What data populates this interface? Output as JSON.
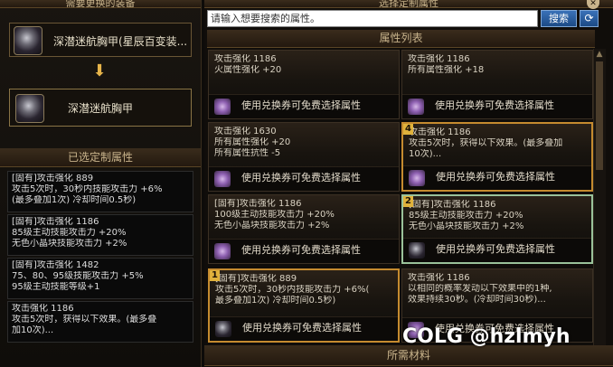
{
  "left": {
    "top_header": "需要更换的装备",
    "source_item_label": "深潜迷航胸甲(星辰百变装...",
    "target_item_label": "深潜迷航胸甲",
    "selected_header": "已选定制属性",
    "selected_attrs": [
      {
        "lines": [
          "[固有]攻击强化 889",
          "攻击5次时，30秒内技能攻击力 +6%",
          "(最多叠加1次) 冷却时间0.5秒)"
        ]
      },
      {
        "lines": [
          "[固有]攻击强化 1186",
          "85级主动技能攻击力 +20%",
          "无色小晶块技能攻击力 +2%"
        ]
      },
      {
        "lines": [
          "[固有]攻击强化 1482",
          "75、80、95级技能攻击力 +5%",
          "95级主动技能等级+1"
        ]
      },
      {
        "lines": [
          "攻击强化 1186",
          "攻击5次时，获得以下效果。(最多叠",
          "加10次)..."
        ]
      }
    ]
  },
  "right": {
    "top_header": "选择定制属性",
    "search_placeholder": "请输入想要搜索的属性。",
    "search_button": "搜索",
    "refresh_icon": "⟳",
    "list_header": "属性列表",
    "footer_text": "使用兑换券可免费选择属性",
    "cards": [
      {
        "lines": [
          "攻击强化 1186",
          "火属性强化 +20"
        ],
        "badge": "",
        "state": "normal",
        "token": "purple"
      },
      {
        "lines": [
          "攻击强化 1186",
          "所有属性强化 +18"
        ],
        "badge": "",
        "state": "normal",
        "token": "purple"
      },
      {
        "lines": [
          "攻击强化 1630",
          "所有属性强化 +20",
          "所有属性抗性 -5"
        ],
        "badge": "",
        "state": "normal",
        "token": "purple"
      },
      {
        "lines": [
          "攻击强化 1186",
          "攻击5次时，获得以下效果。(最多叠加",
          "10次)..."
        ],
        "badge": "4",
        "state": "sel",
        "token": "purple"
      },
      {
        "lines": [
          "[固有]攻击强化 1186",
          "100级主动技能攻击力 +20%",
          "无色小晶块技能攻击力 +2%"
        ],
        "badge": "",
        "state": "normal",
        "token": "purple"
      },
      {
        "lines": [
          "[固有]攻击强化 1186",
          "85级主动技能攻击力 +20%",
          "无色小晶块技能攻击力 +2%"
        ],
        "badge": "2",
        "state": "sel2",
        "token": "dark"
      },
      {
        "lines": [
          "[固有]攻击强化 889",
          "攻击5次时，30秒内技能攻击力 +6%(",
          "最多叠加1次) 冷却时间0.5秒)"
        ],
        "badge": "1",
        "state": "sel",
        "token": "dark"
      },
      {
        "lines": [
          "攻击强化 1186",
          "以相同的概率发动以下效果中的1种,",
          "效果持续30秒。(冷却时间30秒)..."
        ],
        "badge": "",
        "state": "normal",
        "token": "purple"
      }
    ],
    "bottom_header": "所需材料"
  },
  "watermark": "COLG @hzlmyh",
  "colors": {
    "accent": "#c58b2f",
    "selected_alt": "#9ac29a",
    "button_blue": "#2a5fa0"
  }
}
